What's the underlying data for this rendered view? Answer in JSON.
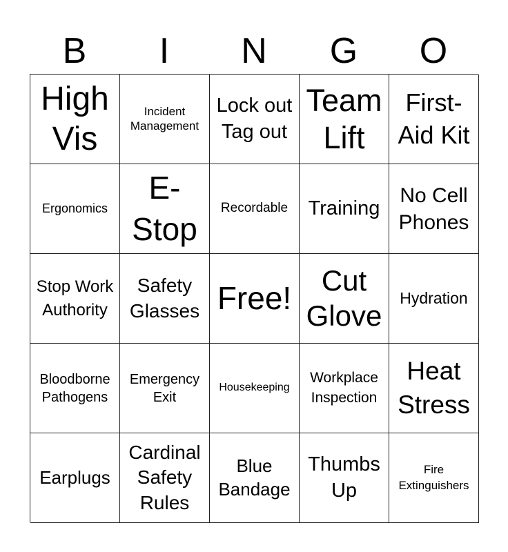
{
  "header": {
    "letters": [
      "B",
      "I",
      "N",
      "G",
      "O"
    ]
  },
  "board": {
    "cells": [
      "High Vis",
      "Incident Management",
      "Lock out Tag out",
      "Team Lift",
      "First-Aid Kit",
      "Ergonomics",
      "E-Stop",
      "Recordable",
      "Training",
      "No Cell Phones",
      "Stop Work Authority",
      "Safety Glasses",
      "Free!",
      "Cut Glove",
      "Hydration",
      "Bloodborne Pathogens",
      "Emergency Exit",
      "Housekeeping",
      "Workplace Inspection",
      "Heat Stress",
      "Earplugs",
      "Cardinal Safety Rules",
      "Blue Bandage",
      "Thumbs Up",
      "Fire Extinguishers"
    ],
    "free_space_index": 12
  }
}
